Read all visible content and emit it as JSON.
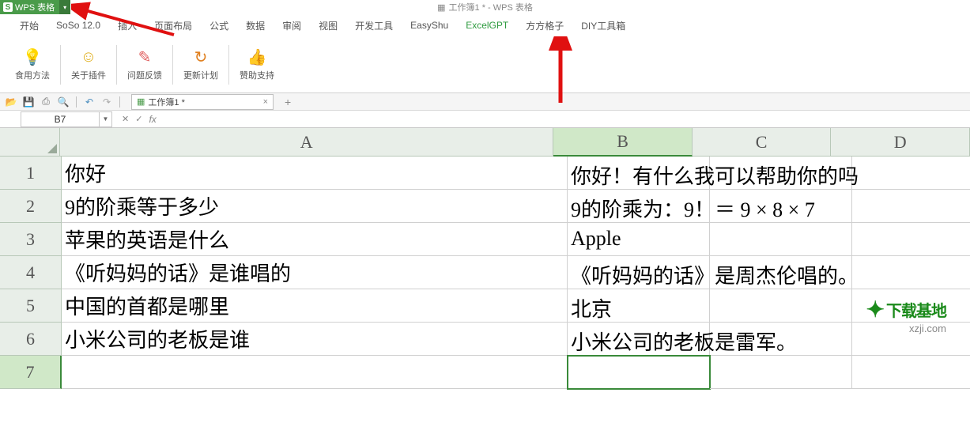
{
  "app": {
    "badge_letter": "S",
    "badge_text": "WPS 表格",
    "title_icon": "▦",
    "title": "工作簿1 * - WPS 表格"
  },
  "menu": [
    "开始",
    "SoSo 12.0",
    "插入",
    "页面布局",
    "公式",
    "数据",
    "审阅",
    "视图",
    "开发工具",
    "EasyShu",
    "ExcelGPT",
    "方方格子",
    "DIY工具箱"
  ],
  "menu_active_index": 10,
  "ribbon": [
    {
      "icon": "💡",
      "label": "食用方法",
      "color": "#b8a030"
    },
    {
      "icon": "☺",
      "label": "关于插件",
      "color": "#e0b020"
    },
    {
      "icon": "✎",
      "label": "问题反馈",
      "color": "#e06060"
    },
    {
      "icon": "↻",
      "label": "更新计划",
      "color": "#e08020"
    },
    {
      "icon": "👍",
      "label": "赞助支持",
      "color": "#e0a020"
    }
  ],
  "qat": {
    "doc_tab": "工作簿1 *"
  },
  "formula": {
    "name_box": "B7",
    "fx": "fx"
  },
  "columns": [
    "A",
    "B",
    "C",
    "D"
  ],
  "active_col_index": 1,
  "rows": [
    1,
    2,
    3,
    4,
    5,
    6,
    7
  ],
  "active_row_index": 6,
  "cells": {
    "A": [
      "你好",
      "9的阶乘等于多少",
      "苹果的英语是什么",
      "《听妈妈的话》是谁唱的",
      "中国的首都是哪里",
      "小米公司的老板是谁",
      ""
    ],
    "B_overflow": [
      "你好！有什么我可以帮助你的吗",
      "9的阶乘为：9！＝ 9 × 8 × 7",
      "Apple",
      "《听妈妈的话》是周杰伦唱的。",
      "北京",
      "小米公司的老板是雷军。",
      ""
    ]
  },
  "watermark": {
    "brand": "下载基地",
    "url": "xzji.com"
  }
}
